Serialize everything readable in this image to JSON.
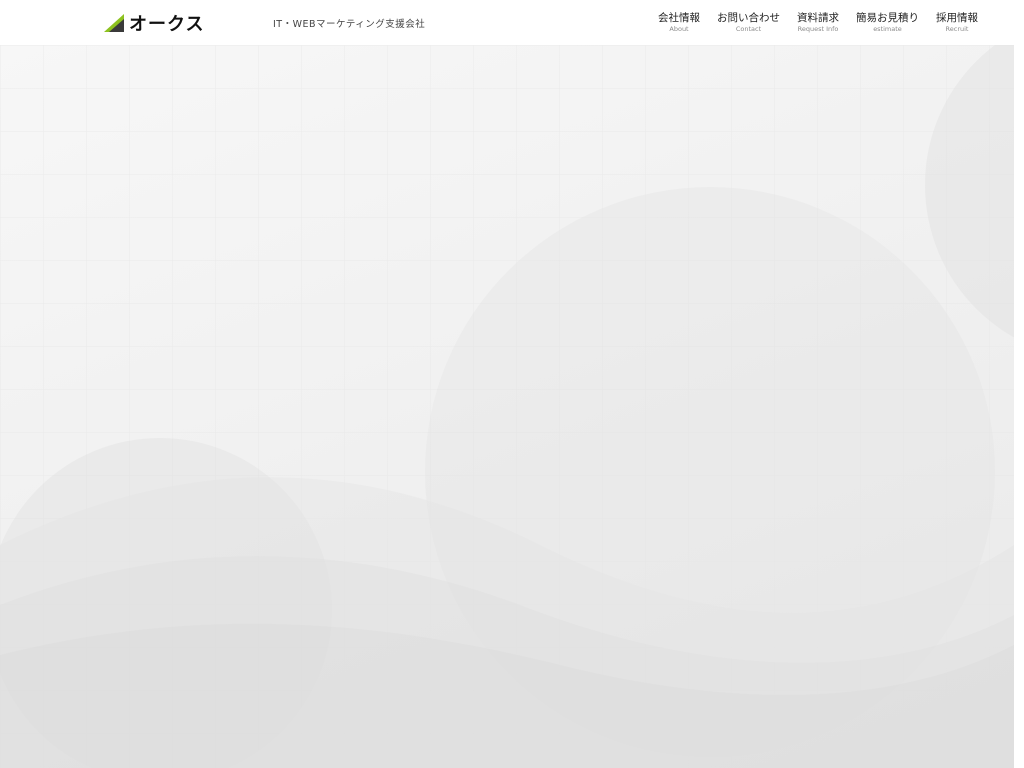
{
  "header": {
    "logo": {
      "text": "オークス",
      "mark_colors": [
        "#8dc21f",
        "#3a3a3a"
      ]
    },
    "tagline": "IT・WEBマーケティング支援会社",
    "nav": [
      {
        "label": "会社情報",
        "sub": "About"
      },
      {
        "label": "お問い合わせ",
        "sub": "Contact"
      },
      {
        "label": "資料請求",
        "sub": "Request Info"
      },
      {
        "label": "簡易お見積り",
        "sub": "estimate"
      },
      {
        "label": "採用情報",
        "sub": "Recruit"
      }
    ]
  },
  "colors": {
    "accent": "#8dc21f",
    "header_bg": "#ffffff",
    "hero_bg": "#f3f3f3"
  }
}
